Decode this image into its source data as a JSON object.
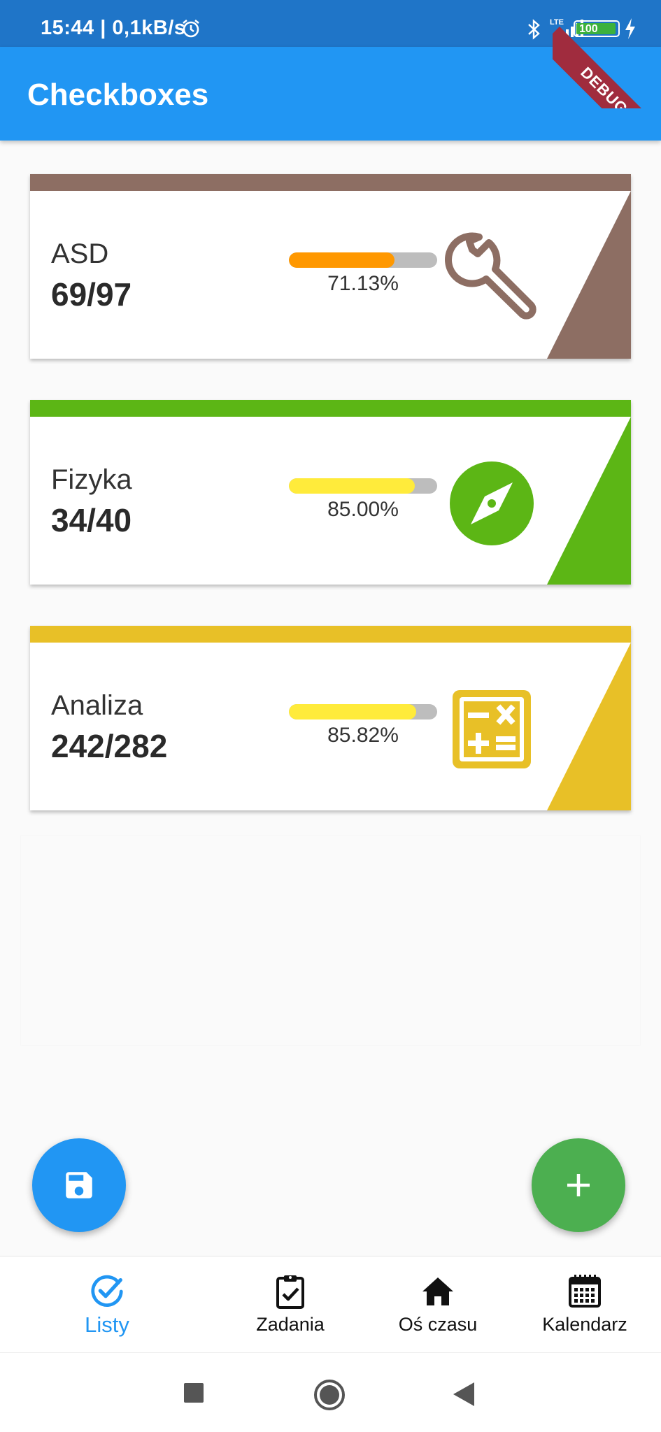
{
  "status_bar": {
    "time": "15:44 | 0,1kB/s",
    "network": "LTE",
    "battery": "100"
  },
  "debug_banner": "DEBUG",
  "app_bar": {
    "title": "Checkboxes"
  },
  "lists": [
    {
      "name": "ASD",
      "count": "69/97",
      "percent_text": "71.13%",
      "progress": 0.7113,
      "accent": "#8d6e63",
      "bar_color": "#ff9800",
      "icon": "wrench-icon"
    },
    {
      "name": "Fizyka",
      "count": "34/40",
      "percent_text": "85.00%",
      "progress": 0.85,
      "accent": "#5cb615",
      "bar_color": "#ffeb3b",
      "icon": "compass-icon"
    },
    {
      "name": "Analiza",
      "count": "242/282",
      "percent_text": "85.82%",
      "progress": 0.8582,
      "accent": "#e8c027",
      "bar_color": "#ffeb3b",
      "icon": "calculator-icon"
    }
  ],
  "fabs": {
    "save_icon": "save-icon",
    "add_icon": "add-icon",
    "save_color": "#2196f3",
    "add_color": "#4caf50"
  },
  "bottom_nav": {
    "active_color": "#2196f3",
    "items": [
      {
        "label": "Listy",
        "icon": "check-circle-icon",
        "active": true
      },
      {
        "label": "Zadania",
        "icon": "clipboard-check-icon",
        "active": false
      },
      {
        "label": "Oś czasu",
        "icon": "home-icon",
        "active": false
      },
      {
        "label": "Kalendarz",
        "icon": "calendar-icon",
        "active": false
      }
    ]
  }
}
